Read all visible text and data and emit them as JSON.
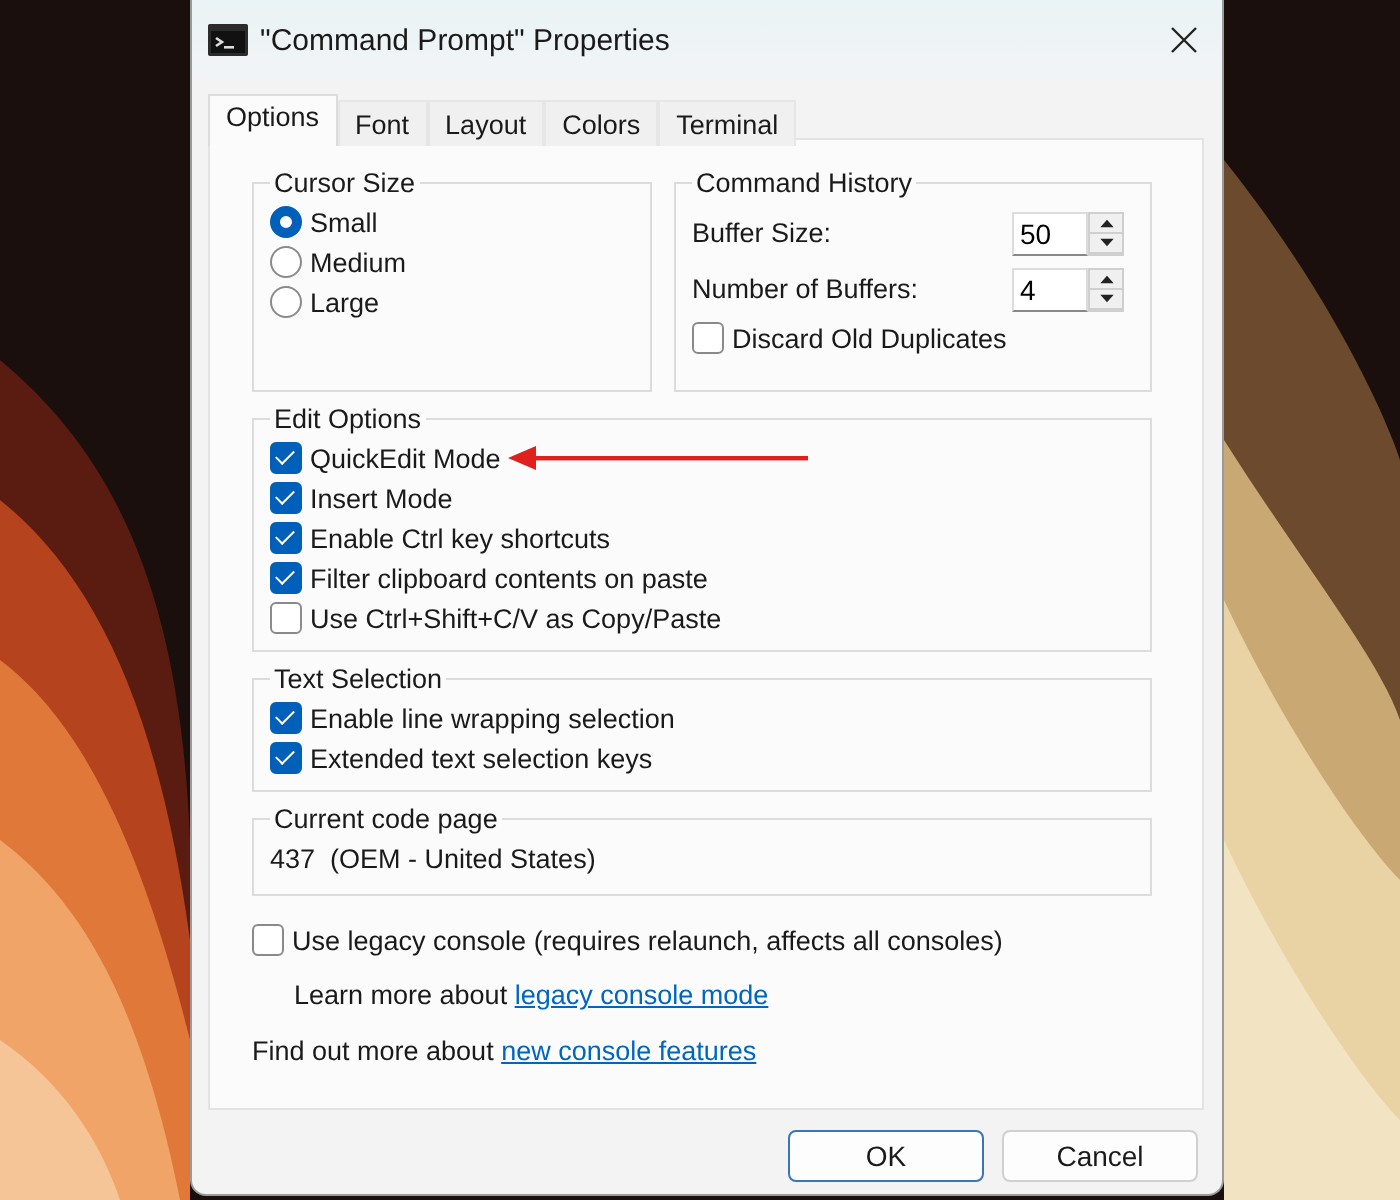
{
  "window": {
    "title": "\"Command Prompt\" Properties"
  },
  "tabs": [
    {
      "label": "Options",
      "selected": true
    },
    {
      "label": "Font",
      "selected": false
    },
    {
      "label": "Layout",
      "selected": false
    },
    {
      "label": "Colors",
      "selected": false
    },
    {
      "label": "Terminal",
      "selected": false
    }
  ],
  "cursor_size": {
    "title": "Cursor Size",
    "options": [
      {
        "label": "Small",
        "selected": true
      },
      {
        "label": "Medium",
        "selected": false
      },
      {
        "label": "Large",
        "selected": false
      }
    ]
  },
  "command_history": {
    "title": "Command History",
    "fields": [
      {
        "label": "Buffer Size:",
        "value": "50"
      },
      {
        "label": "Number of Buffers:",
        "value": "4"
      }
    ],
    "options": [
      {
        "label": "Discard Old Duplicates",
        "checked": false
      }
    ]
  },
  "edit_options": {
    "title": "Edit Options",
    "options": [
      {
        "label": "QuickEdit Mode",
        "checked": true
      },
      {
        "label": "Insert Mode",
        "checked": true
      },
      {
        "label": "Enable Ctrl key shortcuts",
        "checked": true
      },
      {
        "label": "Filter clipboard contents on paste",
        "checked": true
      },
      {
        "label": "Use Ctrl+Shift+C/V as Copy/Paste",
        "checked": false
      }
    ]
  },
  "text_selection": {
    "title": "Text Selection",
    "options": [
      {
        "label": "Enable line wrapping selection",
        "checked": true
      },
      {
        "label": "Extended text selection keys",
        "checked": true
      }
    ]
  },
  "code_page": {
    "title": "Current code page",
    "value": "437  (OEM - United States)"
  },
  "legacy": {
    "label": "Use legacy console (requires relaunch, affects all consoles)",
    "checked": false,
    "note": {
      "text": "Learn more about",
      "link": "legacy console mode"
    }
  },
  "footer_note": {
    "text": "Find out more about",
    "link": "new console features"
  },
  "buttons": [
    {
      "label": "OK",
      "default": true
    },
    {
      "label": "Cancel",
      "default": false
    }
  ]
}
